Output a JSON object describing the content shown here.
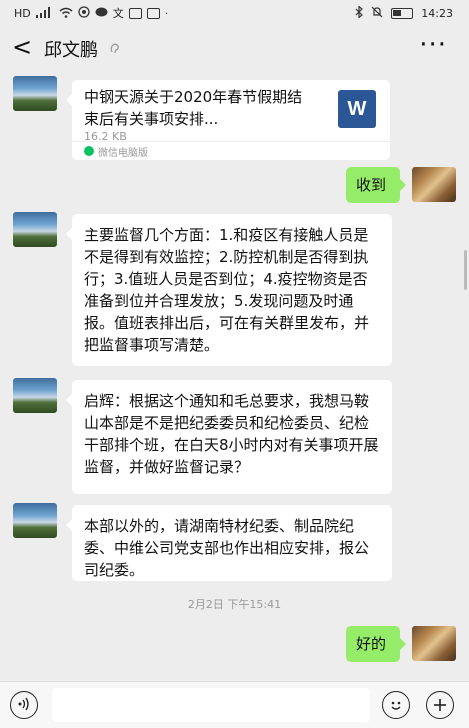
{
  "status_bar": {
    "left_icons": [
      "HD",
      "4G",
      "signal-icon",
      "wifi-icon",
      "location-icon",
      "chat-icon",
      "text-icon",
      "notification-icon",
      "more-dots"
    ],
    "network_label": "HD",
    "text_icon": "文",
    "time": "14:23"
  },
  "header": {
    "back": "<",
    "contact_name": "邱文鹏",
    "more": "···"
  },
  "messages": [
    {
      "sender": "peer",
      "type": "file",
      "title": "中钢天源关于2020年春节假期结束后有关事项安排...",
      "size": "16.2 KB",
      "source": "微信电脑版",
      "file_icon": "W"
    },
    {
      "sender": "self",
      "type": "text",
      "text": "收到"
    },
    {
      "sender": "peer",
      "type": "text",
      "text": "主要监督几个方面：1.和疫区有接触人员是不是得到有效监控；2.防控机制是否得到执行；3.值班人员是否到位；4.疫控物资是否准备到位并合理发放；5.发现问题及时通报。值班表排出后，可在有关群里发布，并把监督事项写清楚。"
    },
    {
      "sender": "peer",
      "type": "text",
      "text": "启辉：根据这个通知和毛总要求，我想马鞍山本部是不是把纪委委员和纪检委员、纪检干部排个班，在白天8小时内对有关事项开展监督，并做好监督记录？"
    },
    {
      "sender": "peer",
      "type": "text",
      "text": "本部以外的，请湖南特材纪委、制品院纪委、中维公司党支部也作出相应安排，报公司纪委。"
    },
    {
      "sender": "system",
      "type": "timestamp",
      "text": "2月2日 下午15:41"
    },
    {
      "sender": "self",
      "type": "text",
      "text": "好的"
    }
  ],
  "input_bar": {
    "voice_icon": "voice-icon",
    "input_value": "",
    "emoji_icon": "emoji-icon",
    "plus_icon": "plus-icon"
  },
  "colors": {
    "background": "#ededed",
    "self_bubble": "#95ec69",
    "peer_bubble": "#ffffff",
    "word_icon": "#2b5797"
  }
}
